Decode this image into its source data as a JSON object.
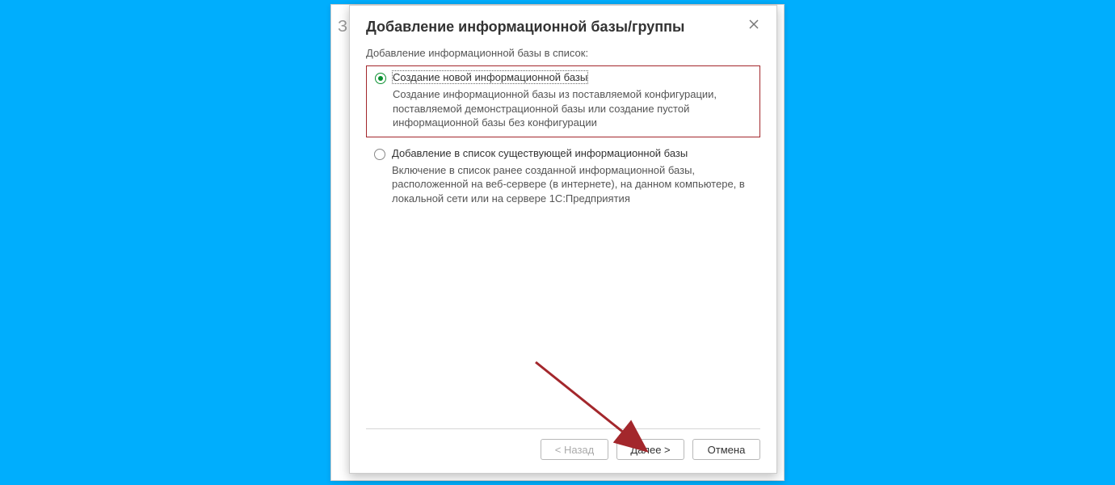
{
  "dialog": {
    "title": "Добавление информационной базы/группы",
    "section_label": "Добавление информационной базы в список:",
    "options": [
      {
        "label": "Создание новой информационной базы",
        "description": "Создание информационной базы из поставляемой конфигурации, поставляемой демонстрационной базы или создание пустой информационной базы без конфигурации",
        "selected": true,
        "highlight": true
      },
      {
        "label": "Добавление в список существующей информационной базы",
        "description": "Включение в список ранее созданной информационной базы, расположенной на веб-сервере (в интернете), на данном компьютере,  в локальной сети или на сервере 1С:Предприятия",
        "selected": false,
        "highlight": false
      }
    ],
    "buttons": {
      "back": "< Назад",
      "next": "Далее >",
      "cancel": "Отмена"
    }
  },
  "annotation": {
    "arrow_color": "#a3272c"
  }
}
